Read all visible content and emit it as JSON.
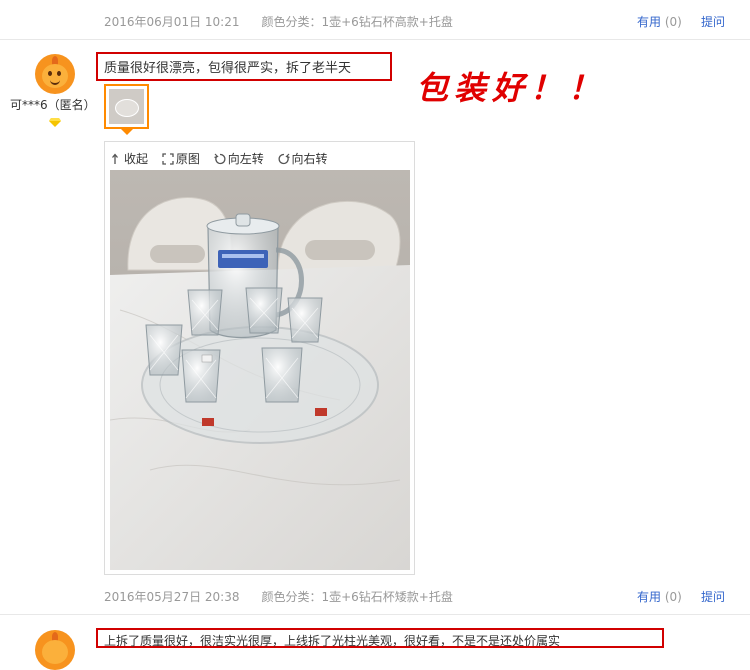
{
  "review_prev": {
    "date": "2016年06月01日 10:21",
    "sku": "颜色分类：1壶+6钻石杯高款+托盘",
    "useful_label": "有用",
    "useful_count": "(0)",
    "ask_label": "提问"
  },
  "review_main": {
    "username": "可***6（匿名）",
    "text": "质量很好很漂亮，包得很严实，拆了老半天",
    "annotation": "包装好！！",
    "toolbar": {
      "collapse": "收起",
      "original": "原图",
      "rotate_left": "向左转",
      "rotate_right": "向右转"
    },
    "date": "2016年05月27日 20:38",
    "sku": "颜色分类：1壶+6钻石杯矮款+托盘",
    "useful_label": "有用",
    "useful_count": "(0)",
    "ask_label": "提问"
  },
  "review_next": {
    "text": "上拆了质量很好，很洁实光很厚，上线拆了光柱光美观，很好看，不是不是还处价属实"
  },
  "colors": {
    "link": "#3366cc",
    "meta": "#999999",
    "highlight_box": "#d10000",
    "thumb_border": "#ff8a00",
    "avatar": "#f7931e"
  },
  "icons": {
    "avatar": "orange-mascot-avatar",
    "level": "diamond-icon",
    "collapse": "arrow-up-icon",
    "original": "expand-icon",
    "rotate_left": "rotate-left-icon",
    "rotate_right": "rotate-right-icon"
  }
}
